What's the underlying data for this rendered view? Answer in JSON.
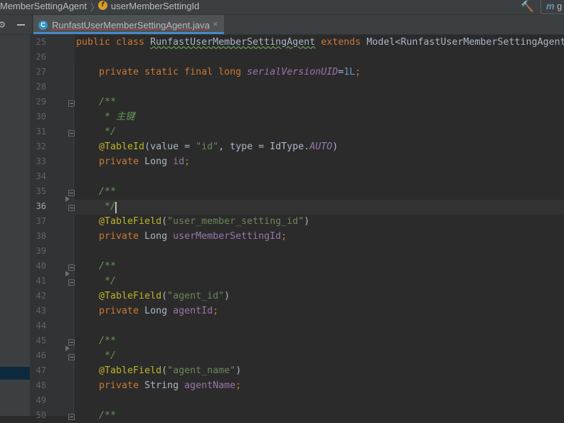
{
  "breadcrumb": {
    "class_crumb": "MemberSettingAgent",
    "field_icon": "f",
    "field_crumb": "userMemberSettingId"
  },
  "toolbar": {
    "maven_label": "m",
    "maven_suffix": "g"
  },
  "tab": {
    "icon_letter": "C",
    "label": "RunfastUserMemberSettingAgent.java",
    "close": "×"
  },
  "colors": {
    "background": "#2b2b2b",
    "keyword": "#cc7832",
    "annotation": "#bbb529",
    "string": "#6a8759",
    "comment": "#629755",
    "field": "#9876aa",
    "number": "#6897bb",
    "tab_accent": "#4a88c7"
  },
  "editor": {
    "current_line": 36,
    "line_numbers": [
      "25",
      "26",
      "27",
      "28",
      "29",
      "30",
      "31",
      "32",
      "33",
      "34",
      "35",
      "36",
      "37",
      "38",
      "39",
      "40",
      "41",
      "42",
      "43",
      "44",
      "45",
      "46",
      "47",
      "48",
      "49",
      "50"
    ],
    "code": {
      "l25": {
        "a": "public class ",
        "b": "RunfastUserMemberSettingAgent",
        "c": " extends ",
        "d": "Model<RunfastUserMemberSettingAgent"
      },
      "l27": {
        "a": "    private static final long ",
        "b": "serialVersionUID",
        "c": "=",
        "d": "1L",
        "e": ";"
      },
      "l29": "    /**",
      "l30": "     * 主键",
      "l31": "     */",
      "l32": {
        "a": "    @TableId",
        "b": "(value = ",
        "c": "\"id\"",
        "d": ", type = IdType.",
        "e": "AUTO",
        "f": ")"
      },
      "l33": {
        "a": "    private ",
        "b": "Long ",
        "c": "id",
        "d": ";"
      },
      "l35": "    /**",
      "l36": "     */",
      "l37": {
        "a": "    @TableField",
        "b": "(",
        "c": "\"user_member_setting_id\"",
        "d": ")"
      },
      "l38": {
        "a": "    private ",
        "b": "Long ",
        "c": "userMemberSettingId",
        "d": ";"
      },
      "l40": "    /**",
      "l41": "     */",
      "l42": {
        "a": "    @TableField",
        "b": "(",
        "c": "\"agent_id\"",
        "d": ")"
      },
      "l43": {
        "a": "    private ",
        "b": "Long ",
        "c": "agentId",
        "d": ";"
      },
      "l45": "    /**",
      "l46": "     */",
      "l47": {
        "a": "    @TableField",
        "b": "(",
        "c": "\"agent_name\"",
        "d": ")"
      },
      "l48": {
        "a": "    private ",
        "b": "String ",
        "c": "agentName",
        "d": ";"
      },
      "l50": "    /**"
    }
  }
}
